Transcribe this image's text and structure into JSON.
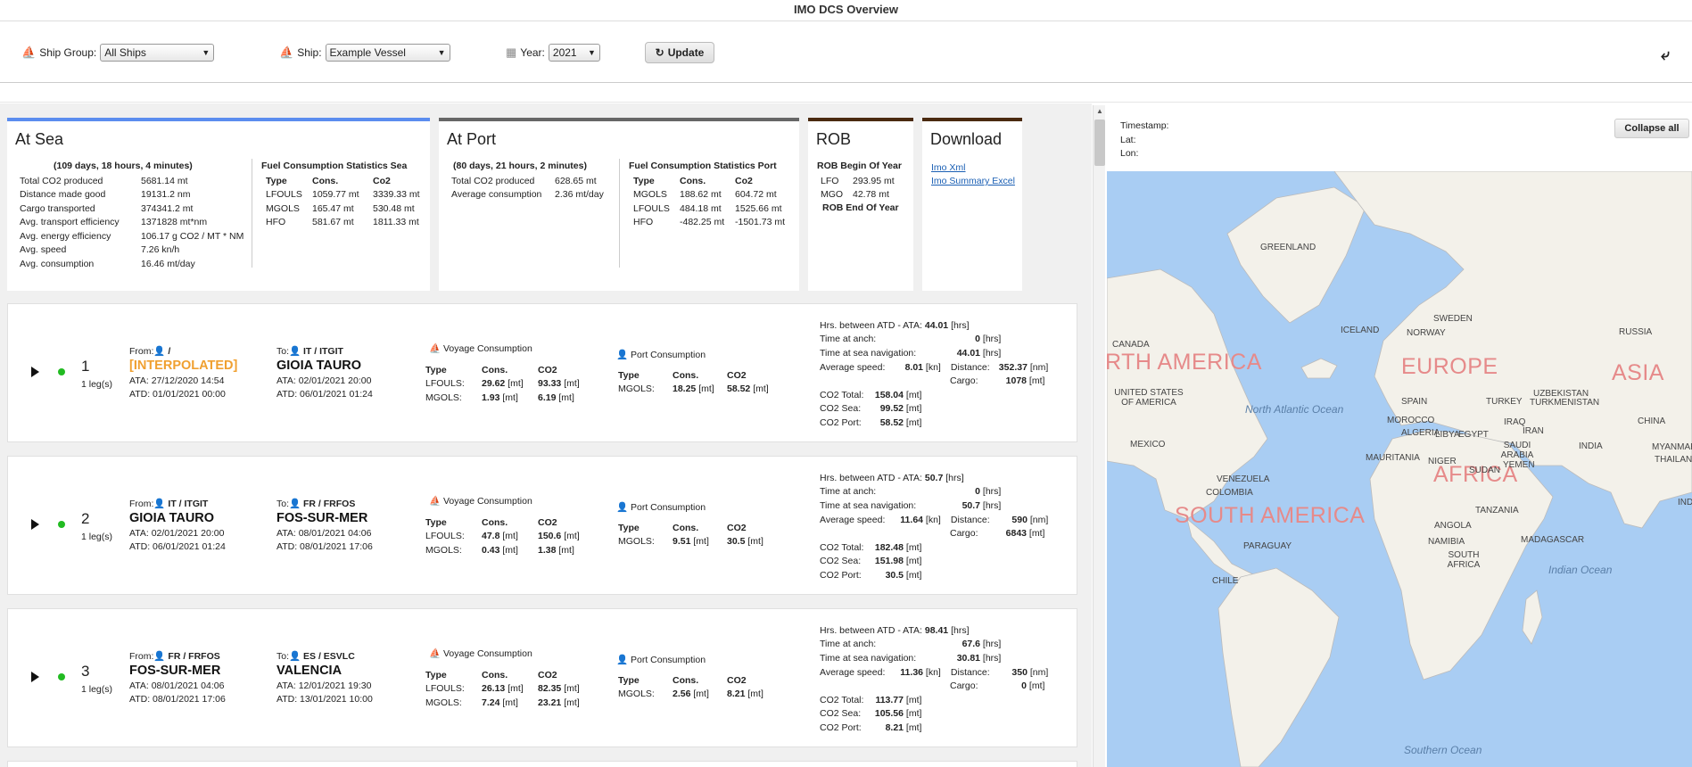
{
  "app": {
    "title": "IMO DCS Overview"
  },
  "toolbar": {
    "ship_group_label": "Ship Group:",
    "ship_group_value": "All Ships",
    "ship_label": "Ship:",
    "ship_value": "Example Vessel",
    "year_label": "Year:",
    "year_value": "2021",
    "update_label": "Update"
  },
  "at_sea": {
    "title": "At Sea",
    "duration": "(109 days, 18 hours, 4 minutes)",
    "stats": [
      {
        "label": "Total CO2 produced",
        "value": "5681.14 mt"
      },
      {
        "label": "Distance made good",
        "value": "19131.2 nm"
      },
      {
        "label": "Cargo transported",
        "value": "374341.2 mt"
      },
      {
        "label": "Avg. transport efficiency",
        "value": "1371828 mt*nm"
      },
      {
        "label": "Avg. energy efficiency",
        "value": "106.17 g CO2 / MT * NM"
      },
      {
        "label": "Avg. speed",
        "value": "7.26 kn/h"
      },
      {
        "label": "Avg. consumption",
        "value": "16.46 mt/day"
      }
    ],
    "fuel_title": "Fuel Consumption Statistics Sea",
    "fuel_headers": [
      "Type",
      "Cons.",
      "Co2"
    ],
    "fuel_rows": [
      [
        "LFOULS",
        "1059.77 mt",
        "3339.33 mt"
      ],
      [
        "MGOLS",
        "165.47 mt",
        "530.48 mt"
      ],
      [
        "HFO",
        "581.67 mt",
        "1811.33 mt"
      ]
    ]
  },
  "at_port": {
    "title": "At Port",
    "duration": "(80 days, 21 hours, 2 minutes)",
    "stats": [
      {
        "label": "Total CO2 produced",
        "value": "628.65 mt"
      },
      {
        "label": "Average consumption",
        "value": "2.36 mt/day"
      }
    ],
    "fuel_title": "Fuel Consumption Statistics Port",
    "fuel_headers": [
      "Type",
      "Cons.",
      "Co2"
    ],
    "fuel_rows": [
      [
        "MGOLS",
        "188.62 mt",
        "604.72 mt"
      ],
      [
        "LFOULS",
        "484.18 mt",
        "1525.66 mt"
      ],
      [
        "HFO",
        "-482.25 mt",
        "-1501.73 mt"
      ]
    ]
  },
  "rob": {
    "title": "ROB",
    "begin_label": "ROB Begin Of Year",
    "rows": [
      [
        "LFO",
        "293.95 mt"
      ],
      [
        "MGO",
        "42.78 mt"
      ]
    ],
    "end_label": "ROB End Of Year"
  },
  "download": {
    "title": "Download",
    "links": [
      "Imo Xml",
      "Imo Summary Excel"
    ]
  },
  "legs": [
    {
      "num": "1",
      "leg_count": "1 leg(s)",
      "from_code": "/",
      "from_name": "[INTERPOLATED]",
      "from_interpolated": true,
      "from_ata": "ATA: 27/12/2020 14:54",
      "from_atd": "ATD: 01/01/2021 00:00",
      "to_code": "IT / ITGIT",
      "to_name": "GIOIA TAURO",
      "to_ata": "ATA: 02/01/2021 20:00",
      "to_atd": "ATD: 06/01/2021 01:24",
      "voyage_rows": [
        [
          "LFOULS:",
          "29.62",
          "93.33"
        ],
        [
          "MGOLS:",
          "1.93",
          "6.19"
        ]
      ],
      "port_rows": [
        [
          "MGOLS:",
          "18.25",
          "58.52"
        ]
      ],
      "hrs_between": "44.01",
      "time_anch": "0",
      "time_sea": "44.01",
      "avg_speed": "8.01",
      "distance": "352.37",
      "cargo": "1078",
      "co2_total": "158.04",
      "co2_sea": "99.52",
      "co2_port": "58.52"
    },
    {
      "num": "2",
      "leg_count": "1 leg(s)",
      "from_code": "IT / ITGIT",
      "from_name": "GIOIA TAURO",
      "from_interpolated": false,
      "from_ata": "ATA: 02/01/2021 20:00",
      "from_atd": "ATD: 06/01/2021 01:24",
      "to_code": "FR / FRFOS",
      "to_name": "FOS-SUR-MER",
      "to_ata": "ATA: 08/01/2021 04:06",
      "to_atd": "ATD: 08/01/2021 17:06",
      "voyage_rows": [
        [
          "LFOULS:",
          "47.8",
          "150.6"
        ],
        [
          "MGOLS:",
          "0.43",
          "1.38"
        ]
      ],
      "port_rows": [
        [
          "MGOLS:",
          "9.51",
          "30.5"
        ]
      ],
      "hrs_between": "50.7",
      "time_anch": "0",
      "time_sea": "50.7",
      "avg_speed": "11.64",
      "distance": "590",
      "cargo": "6843",
      "co2_total": "182.48",
      "co2_sea": "151.98",
      "co2_port": "30.5"
    },
    {
      "num": "3",
      "leg_count": "1 leg(s)",
      "from_code": "FR / FRFOS",
      "from_name": "FOS-SUR-MER",
      "from_interpolated": false,
      "from_ata": "ATA: 08/01/2021 04:06",
      "from_atd": "ATD: 08/01/2021 17:06",
      "to_code": "ES / ESVLC",
      "to_name": "VALENCIA",
      "to_ata": "ATA: 12/01/2021 19:30",
      "to_atd": "ATD: 13/01/2021 10:00",
      "voyage_rows": [
        [
          "LFOULS:",
          "26.13",
          "82.35"
        ],
        [
          "MGOLS:",
          "7.24",
          "23.21"
        ]
      ],
      "port_rows": [
        [
          "MGOLS:",
          "2.56",
          "8.21"
        ]
      ],
      "hrs_between": "98.41",
      "time_anch": "67.6",
      "time_sea": "30.81",
      "avg_speed": "11.36",
      "distance": "350",
      "cargo": "0",
      "co2_total": "113.77",
      "co2_sea": "105.56",
      "co2_port": "8.21"
    }
  ],
  "leg_labels": {
    "from": "From:",
    "to": "To:",
    "voyage_consumption": "Voyage Consumption",
    "port_consumption": "Port Consumption",
    "type": "Type",
    "cons": "Cons.",
    "co2": "CO2",
    "unit_mt": "[mt]",
    "hrs_between": "Hrs. between ATD - ATA:",
    "time_anch": "Time at anch:",
    "time_sea": "Time at sea navigation:",
    "avg_speed": "Average speed:",
    "distance": "Distance:",
    "cargo": "Cargo:",
    "co2_total": "CO2 Total:",
    "co2_sea": "CO2 Sea:",
    "co2_port": "CO2 Port:",
    "unit_hrs": "[hrs]",
    "unit_kn": "[kn]",
    "unit_nm": "[nm]"
  },
  "map_panel": {
    "timestamp_label": "Timestamp:",
    "lat_label": "Lat:",
    "lon_label": "Lon:",
    "collapse_label": "Collapse all"
  },
  "map_labels": {
    "continents": [
      "RTH AMERICA",
      "EUROPE",
      "ASIA",
      "AFRICA",
      "SOUTH AMERICA"
    ],
    "oceans": [
      "North Atlantic Ocean",
      "Indian Ocean",
      "Southern Ocean"
    ],
    "countries": [
      "GREENLAND",
      "ICELAND",
      "SWEDEN",
      "NORWAY",
      "RUSSIA",
      "CANADA",
      "UNITED STATES OF AMERICA",
      "SPAIN",
      "TURKEY",
      "UZBEKISTAN",
      "TURKMENISTAN",
      "CHINA",
      "MOROCCO",
      "ALGERIA",
      "LIBYA",
      "EGYPT",
      "IRAQ",
      "IRAN",
      "MEXICO",
      "SAUDI ARABIA",
      "INDIA",
      "MAURITANIA",
      "NIGER",
      "SUDAN",
      "YEMEN",
      "MYANMAR",
      "THAILAND",
      "VENEZUELA",
      "COLOMBIA",
      "TANZANIA",
      "ANGOLA",
      "PARAGUAY",
      "NAMIBIA",
      "MADAGASCAR",
      "SOUTH AFRICA",
      "CHILE",
      "IND"
    ]
  },
  "colors": {
    "at_sea_accent": "#5b8def",
    "at_port_accent": "#666666",
    "rob_accent": "#4a2a10",
    "green_dot": "#22bb22",
    "interpolated": "#f0a030",
    "map_water": "#a9cdf3",
    "map_land": "#f3f1ea"
  }
}
